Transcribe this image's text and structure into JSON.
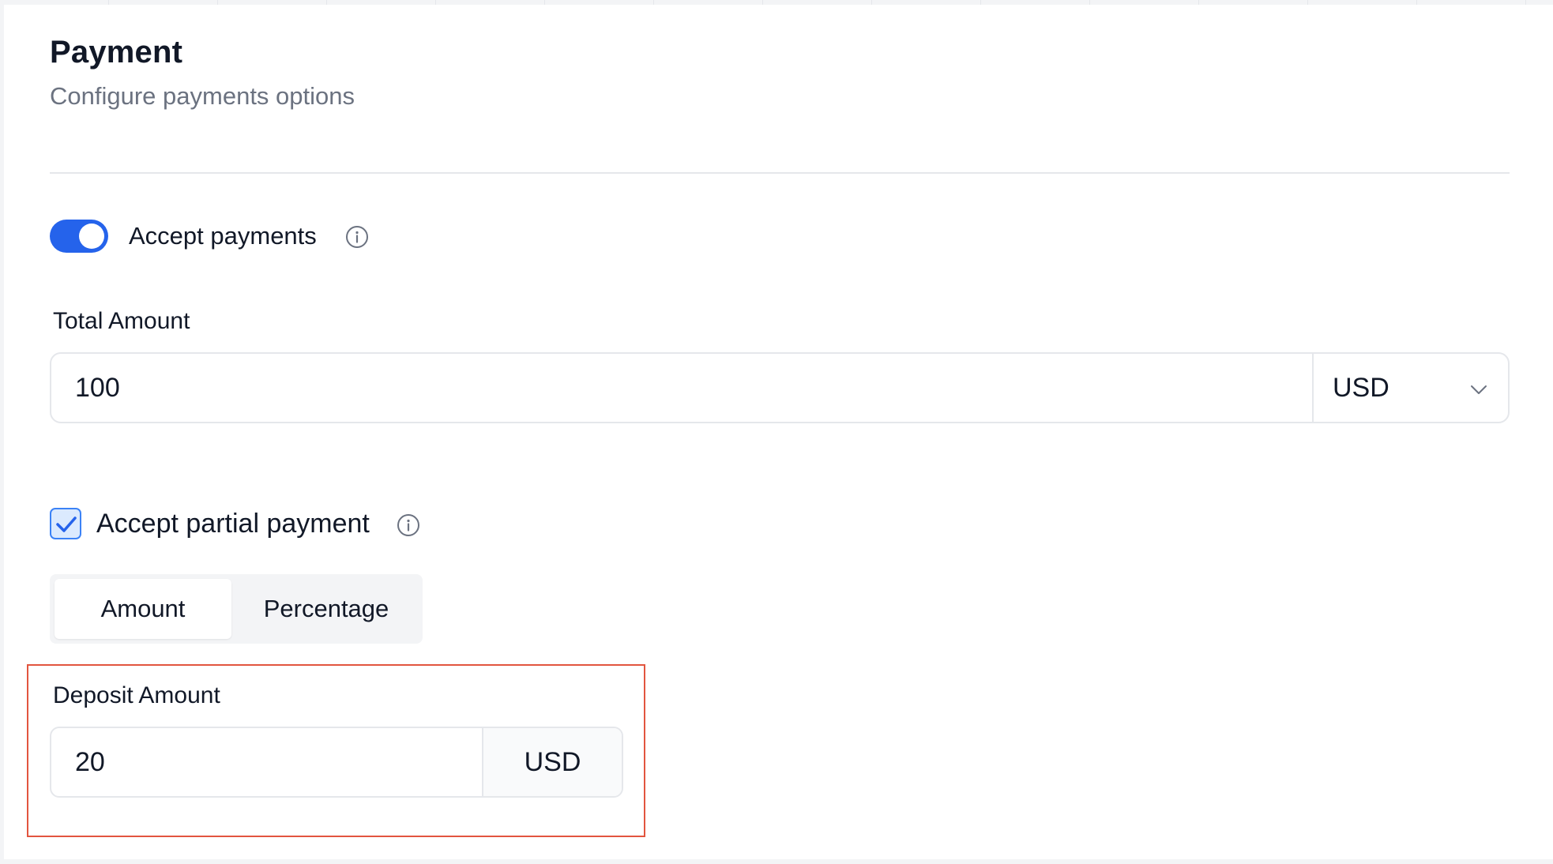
{
  "header": {
    "title": "Payment",
    "subtitle": "Configure payments options"
  },
  "accept_payments": {
    "label": "Accept payments",
    "enabled": true,
    "info_icon": "info-icon"
  },
  "total_amount": {
    "label": "Total Amount",
    "value": "100",
    "currency": "USD"
  },
  "partial_payment": {
    "label": "Accept partial payment",
    "checked": true,
    "info_icon": "info-icon"
  },
  "partial_mode": {
    "options": [
      "Amount",
      "Percentage"
    ],
    "selected": "Amount"
  },
  "deposit_amount": {
    "label": "Deposit Amount",
    "value": "20",
    "currency": "USD"
  },
  "colors": {
    "accent": "#2563eb",
    "highlight_border": "#e2553f",
    "muted_text": "#6b7280",
    "border": "#e5e7eb"
  }
}
